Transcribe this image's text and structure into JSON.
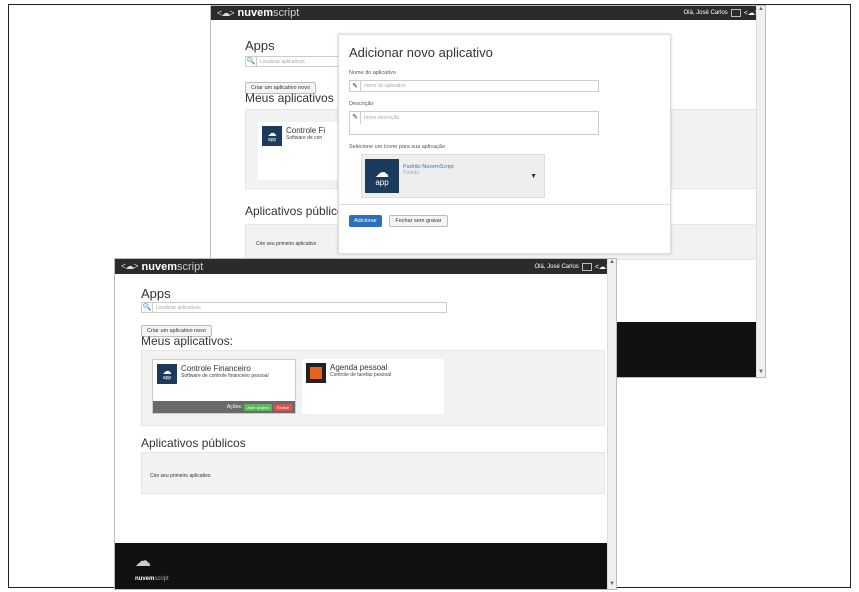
{
  "brand": {
    "logo": "<☁>",
    "name_bold": "nuvem",
    "name_light": "script"
  },
  "user": {
    "greeting": "Olá, José Carlos",
    "logo": "<☁>"
  },
  "apps_page": {
    "title": "Apps",
    "search_placeholder": "Localizar aplicativos",
    "create_button": "Criar um aplicativo novo",
    "my_apps_title": "Meus aplicativos:",
    "my_apps_title_back": "Meus aplicativos",
    "public_title": "Aplicativos públicos",
    "public_empty": "Crie seu primeiro aplicativo.",
    "public_empty_back": "Crie seu primeiro aplicativo"
  },
  "my_apps": [
    {
      "name": "Controle Financeiro",
      "description": "Software de controle financeiro pessoal",
      "icon": "app",
      "actions_label": "Ações:",
      "open_label": "Abrir projeto",
      "delete_label": "Excluir"
    },
    {
      "name": "Agenda pessoal",
      "description": "Controle de tarefas pessoal"
    }
  ],
  "back_card": {
    "name": "Controle Fi",
    "description": "Software de con",
    "icon_label": "app"
  },
  "modal": {
    "title": "Adicionar novo aplicativo",
    "name_label": "Nome do aplicativo",
    "name_placeholder": "nome do aplicativo",
    "desc_label": "Descrição",
    "desc_placeholder": "breve descrição",
    "icon_label": "Selecione um ícone para sua aplicação",
    "icon_option_name": "Padrão NuvemScript",
    "icon_option_sub": "Padrão",
    "icon_option_label": "app",
    "add_button": "Adicionar",
    "close_button": "Fechar sem gravar"
  },
  "footer": {
    "brand_bold": "nuvem",
    "brand_light": "script"
  },
  "colors": {
    "topbar": "#2b2b2b",
    "primary": "#2a6fb8",
    "success": "#5cb85c",
    "danger": "#d9534f",
    "app_icon": "#1b3a5c"
  }
}
